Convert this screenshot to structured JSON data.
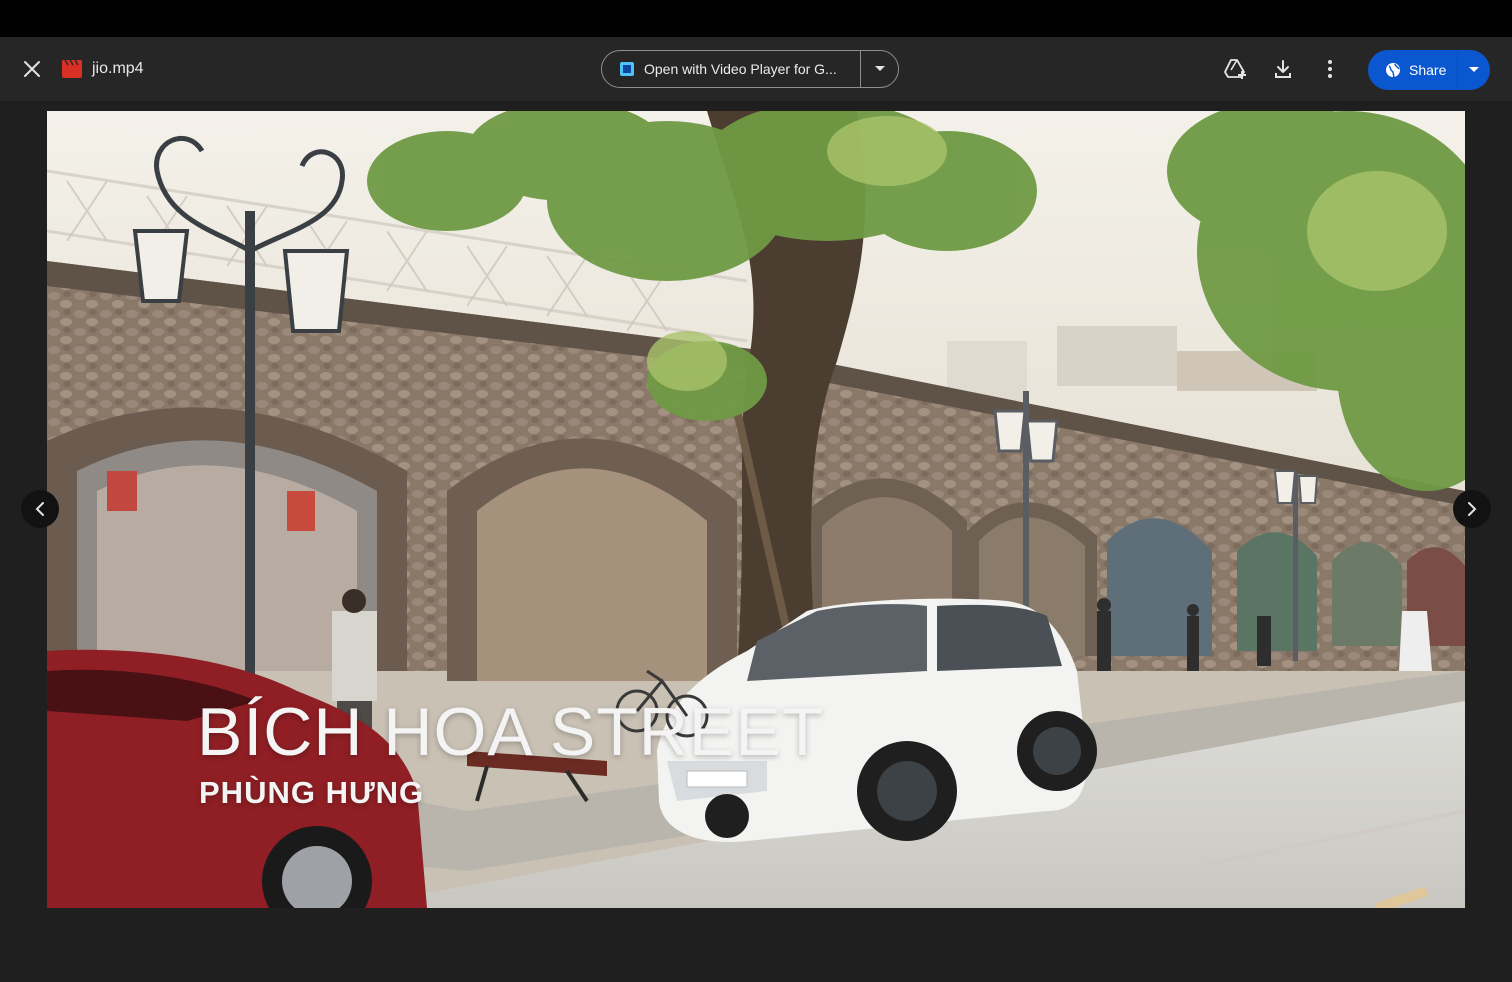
{
  "window": {
    "file_name": "jio.mp4"
  },
  "toolbar": {
    "close_icon": "close-icon",
    "open_with_label": "Open with Video Player for G...",
    "open_with_dropdown_icon": "caret-down-icon",
    "add_to_drive_icon": "add-to-drive-icon",
    "download_icon": "download-icon",
    "more_icon": "more-vert-icon",
    "share_label": "Share",
    "share_dropdown_icon": "caret-down-icon"
  },
  "video": {
    "caption_title": "BÍCH HOA STREET",
    "caption_subtitle": "PHÙNG HƯNG"
  },
  "navigation": {
    "previous_icon": "chevron-left-icon",
    "next_icon": "chevron-right-icon"
  },
  "colors": {
    "share_button": "#0b57d0",
    "background": "#1f1f1f",
    "file_icon": "#d93025"
  }
}
